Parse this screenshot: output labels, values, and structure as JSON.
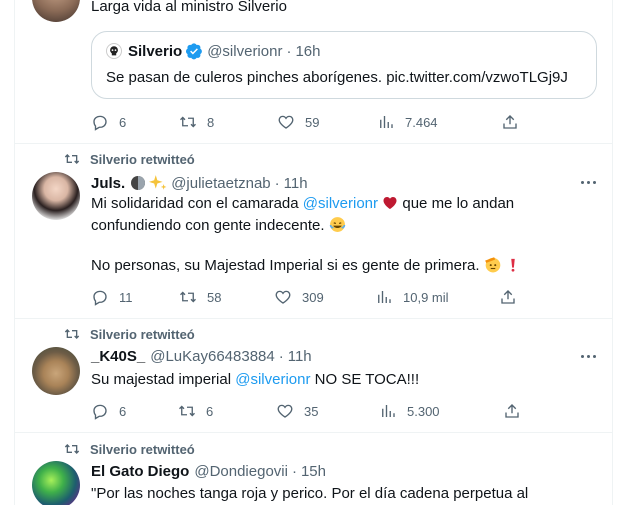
{
  "top_tweet": {
    "text": "Larga vida al ministro Silverio",
    "quote": {
      "name": "Silverio",
      "handle": "@silverionr",
      "time": "16h",
      "text": "Se pasan de culeros pinches aborígenes. pic.twitter.com/vzwoTLGj9J"
    },
    "stats": {
      "replies": "6",
      "retweets": "8",
      "likes": "59",
      "views": "7.464"
    }
  },
  "tweets": [
    {
      "retweeted_by": "Silverio retwitteó",
      "name": "Juls.",
      "handle": "@julietaetznab",
      "time": "11h",
      "text_1a": "Mi solidaridad con el camarada ",
      "mention": "@silverionr",
      "text_1b": " que me lo andan",
      "text_2": "confundiendo con gente indecente.",
      "text_3": "No personas, su Majestad Imperial si es gente de primera.",
      "stats": {
        "replies": "11",
        "retweets": "58",
        "likes": "309",
        "views": "10,9 mil"
      }
    },
    {
      "retweeted_by": "Silverio retwitteó",
      "name": "_K40S_",
      "handle": "@LuKay66483884",
      "time": "11h",
      "text_a": "Su majestad imperial ",
      "mention": "@silverionr",
      "text_b": " NO SE TOCA!!!",
      "stats": {
        "replies": "6",
        "retweets": "6",
        "likes": "35",
        "views": "5.300"
      }
    },
    {
      "retweeted_by": "Silverio retwitteó",
      "name": "El Gato Diego",
      "handle": "@Dondiegovii",
      "time": "15h",
      "text": "\"Por las noches tanga roja y perico. Por el día cadena perpetua al"
    }
  ],
  "colors": {
    "accent": "#1d9bf0",
    "muted": "#536471",
    "border": "#eff3f4",
    "verified": "#1d9bf0"
  },
  "icons": [
    "reply-icon",
    "retweet-icon",
    "like-icon",
    "views-icon",
    "share-icon",
    "more-icon",
    "verified-icon"
  ]
}
